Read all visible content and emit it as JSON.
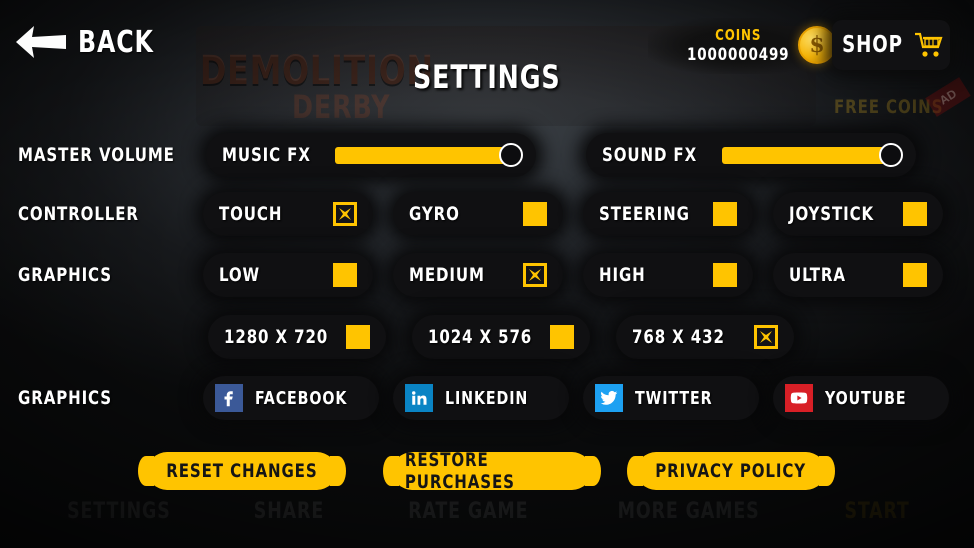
{
  "header": {
    "back_label": "BACK",
    "back_icon": "arrow-left-icon",
    "title": "SETTINGS",
    "coins_label": "COINS",
    "coins_value": "1000000499",
    "coin_icon": "coin-icon",
    "shop_label": "SHOP",
    "cart_icon": "shopping-cart-icon"
  },
  "background": {
    "game_title_line1": "DEMOLITION",
    "game_title_line2": "DERBY",
    "free_coins_label": "FREE COINS",
    "ad_badge": "AD",
    "menu_items": [
      {
        "label": "SETTINGS",
        "accent": false
      },
      {
        "label": "SHARE",
        "accent": false
      },
      {
        "label": "RATE GAME",
        "accent": false
      },
      {
        "label": "MORE GAMES",
        "accent": false
      },
      {
        "label": "START",
        "accent": true
      }
    ]
  },
  "rows": {
    "master_volume": {
      "label": "MASTER VOLUME",
      "sliders": [
        {
          "label": "MUSIC FX",
          "value": 95
        },
        {
          "label": "SOUND FX",
          "value": 95
        }
      ]
    },
    "controller": {
      "label": "CONTROLLER",
      "options": [
        {
          "label": "TOUCH",
          "checked": true
        },
        {
          "label": "GYRO",
          "checked": false
        },
        {
          "label": "STEERING",
          "checked": false
        },
        {
          "label": "JOYSTICK",
          "checked": false
        }
      ]
    },
    "graphics_quality": {
      "label": "GRAPHICS",
      "options": [
        {
          "label": "LOW",
          "checked": false
        },
        {
          "label": "MEDIUM",
          "checked": true
        },
        {
          "label": "HIGH",
          "checked": false
        },
        {
          "label": "ULTRA",
          "checked": false
        }
      ]
    },
    "resolution": {
      "label": "",
      "options": [
        {
          "label": "1280 X 720",
          "checked": false
        },
        {
          "label": "1024 X 576",
          "checked": false
        },
        {
          "label": "768 X 432",
          "checked": true
        }
      ]
    },
    "social": {
      "label": "GRAPHICS",
      "options": [
        {
          "label": "FACEBOOK",
          "icon": "facebook-icon",
          "color": "#3b5998"
        },
        {
          "label": "LINKEDIN",
          "icon": "linkedin-icon",
          "color": "#0a84c4"
        },
        {
          "label": "TWITTER",
          "icon": "twitter-icon",
          "color": "#1da1f2"
        },
        {
          "label": "YOUTUBE",
          "icon": "youtube-icon",
          "color": "#d81f26"
        }
      ]
    }
  },
  "actions": [
    {
      "label": "RESET CHANGES"
    },
    {
      "label": "RESTORE PURCHASES"
    },
    {
      "label": "PRIVACY POLICY"
    }
  ],
  "colors": {
    "accent": "#FFC400",
    "pill_bg": "#101012",
    "text": "#FFFFFF"
  }
}
